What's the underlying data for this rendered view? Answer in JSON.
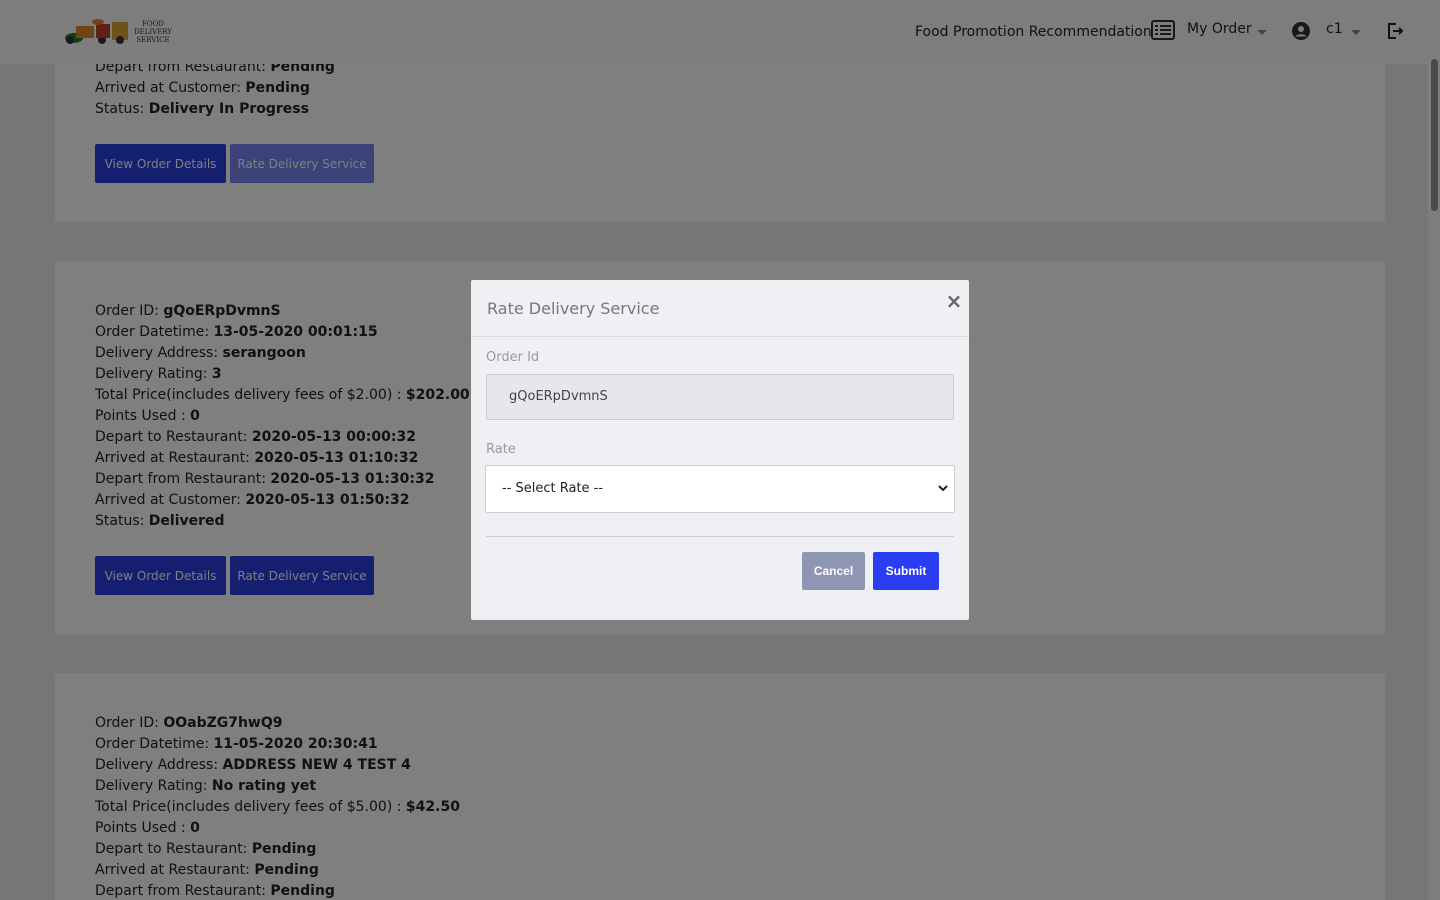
{
  "navbar": {
    "logo_text": [
      "FOOD",
      "DELIVERY",
      "SERVICE"
    ],
    "promo_label": "Food Promotion Recommendation",
    "order_label": "My Order",
    "user_label": "c1"
  },
  "orders": [
    {
      "lines": [
        {
          "label": "Depart from Restaurant: ",
          "value": "Pending"
        },
        {
          "label": "Arrived at Customer: ",
          "value": "Pending"
        },
        {
          "label": "Status: ",
          "value": "Delivery In Progress"
        }
      ],
      "view_label": "View Order Details",
      "rate_label": "Rate Delivery Service"
    },
    {
      "lines": [
        {
          "label": "Order ID: ",
          "value": "gQoERpDvmnS"
        },
        {
          "label": "Order Datetime: ",
          "value": "13-05-2020 00:01:15"
        },
        {
          "label": "Delivery Address: ",
          "value": "serangoon"
        },
        {
          "label": "Delivery Rating: ",
          "value": "3"
        },
        {
          "label": "Total Price(includes delivery fees of $2.00) : ",
          "value": "$202.00"
        },
        {
          "label": "Points Used : ",
          "value": "0"
        },
        {
          "label": "Depart to Restaurant: ",
          "value": "2020-05-13 00:00:32"
        },
        {
          "label": "Arrived at Restaurant: ",
          "value": "2020-05-13 01:10:32"
        },
        {
          "label": "Depart from Restaurant: ",
          "value": "2020-05-13 01:30:32"
        },
        {
          "label": "Arrived at Customer: ",
          "value": "2020-05-13 01:50:32"
        },
        {
          "label": "Status: ",
          "value": "Delivered"
        }
      ],
      "view_label": "View Order Details",
      "rate_label": "Rate Delivery Service"
    },
    {
      "lines": [
        {
          "label": "Order ID: ",
          "value": "OOabZG7hwQ9"
        },
        {
          "label": "Order Datetime: ",
          "value": "11-05-2020 20:30:41"
        },
        {
          "label": "Delivery Address: ",
          "value": "ADDRESS NEW 4 TEST 4"
        },
        {
          "label": "Delivery Rating: ",
          "value": "No rating yet"
        },
        {
          "label": "Total Price(includes delivery fees of $5.00) : ",
          "value": "$42.50"
        },
        {
          "label": "Points Used : ",
          "value": "0"
        },
        {
          "label": "Depart to Restaurant: ",
          "value": "Pending"
        },
        {
          "label": "Arrived at Restaurant: ",
          "value": "Pending"
        },
        {
          "label": "Depart from Restaurant: ",
          "value": "Pending"
        }
      ]
    }
  ],
  "modal": {
    "title": "Rate Delivery Service",
    "close_symbol": "×",
    "order_id_label": "Order Id",
    "order_id_value": "gQoERpDvmnS",
    "rate_label": "Rate",
    "rate_selected": "-- Select Rate --",
    "cancel_label": "Cancel",
    "submit_label": "Submit"
  },
  "colors": {
    "primary_button": "#2a3ee0",
    "submit_button": "#2b3df2",
    "cancel_button": "#8d97b4"
  }
}
